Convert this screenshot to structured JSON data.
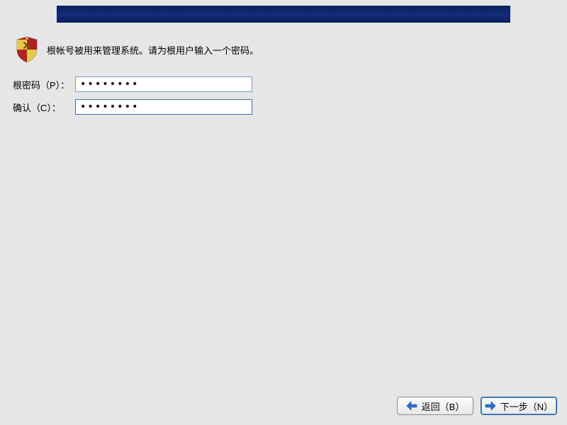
{
  "instruction": "根帐号被用来管理系统。请为根用户输入一个密码。",
  "form": {
    "password_label": "根密码（P）：",
    "confirm_label": "确认（C）：",
    "password_value": "••••••••",
    "confirm_value": "••••••••"
  },
  "buttons": {
    "back_label": "返回（B）",
    "next_label": "下一步（N）"
  },
  "colors": {
    "banner_dark": "#0a1f5c",
    "banner_mid": "#142d7a",
    "bg": "#e6e6e6",
    "input_border": "#7a9cc5",
    "arrow_blue": "#2a6fd6"
  }
}
